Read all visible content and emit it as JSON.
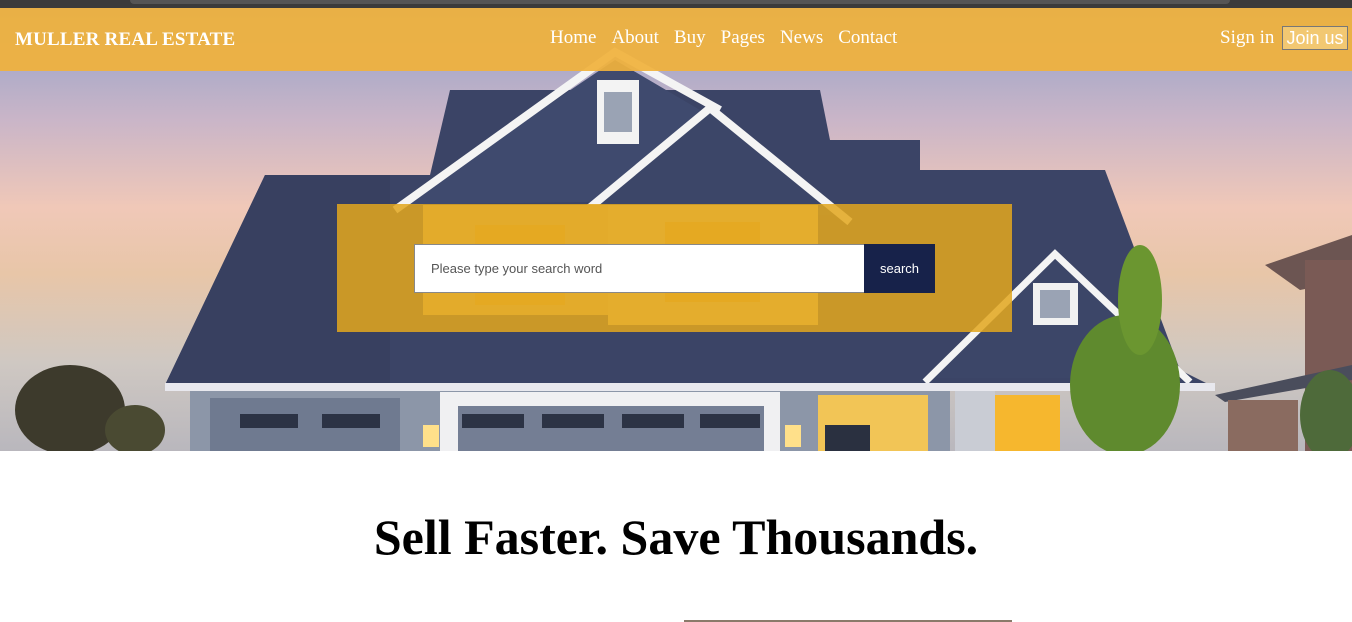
{
  "brand": "MULLER REAL ESTATE",
  "nav": [
    "Home",
    "About",
    "Buy",
    "Pages",
    "News",
    "Contact"
  ],
  "auth": {
    "signin": "Sign in",
    "join": "Join us"
  },
  "search": {
    "placeholder": "Please type your search word",
    "button": "search"
  },
  "headline": "Sell Faster. Save Thousands.",
  "colors": {
    "accent": "#f0b23c",
    "overlay": "#e2a61e",
    "search_button": "#17224a",
    "roof": "#3b4466"
  }
}
